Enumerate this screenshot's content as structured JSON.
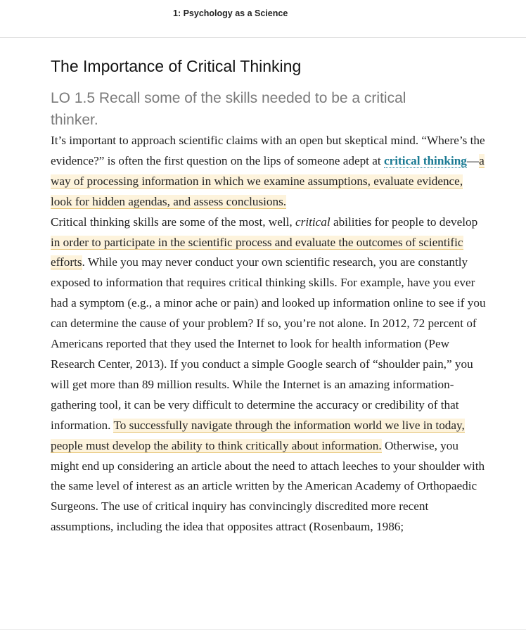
{
  "header": {
    "chapter_title": "1: Psychology as a Science"
  },
  "section": {
    "title": "The Importance of Critical Thinking",
    "learning_objective": "LO 1.5 Recall some of the skills needed to be a critical thinker."
  },
  "paragraph1": {
    "intro": "It’s important to approach scientific claims with an open but skeptical mind. “Where’s the evidence?” is often the first question on the lips of someone adept at ",
    "term": "critical thinking",
    "dash": "—",
    "definition": "a way of processing information in which we examine assumptions, evaluate evidence, look for hidden agendas, and assess conclusions."
  },
  "paragraph2": {
    "s1": "Critical thinking skills are some of the most, well, ",
    "s1_em": "critical",
    "s1_end": " abilities for people to develop ",
    "h1": "in order to participate in the scientific process and evaluate the outcomes of scientific efforts",
    "s2": ". While you may never conduct your own scientific research, you are constantly exposed to information that requires critical thinking skills. For example, have you ever had a symptom (e.g., a minor ache or pain) and looked up information online to see if you can determine the cause of your problem? If so, you’re not alone. In 2012, 72 percent of Americans reported that they used the Internet to look for health information (Pew Research Center, 2013). If you conduct a simple Google search of “shoulder pain,” you will get more than 89 million results. While the Internet is an amazing information-gathering tool, it can be very difficult to determine the accuracy or credibility of that information. ",
    "h2": "To successfully navigate through the information world we live in today, people must develop the ability to think critically about information.",
    "s3": " Otherwise, you might end up considering an article about the need to attach leeches to your shoulder with the same level of interest as an article written by the American Academy of Orthopaedic Surgeons. The use of critical inquiry has convincingly discredited more recent assumptions, including the idea that opposites attract (Rosenbaum, 1986;"
  },
  "colors": {
    "highlight_bg": "#fdf3dc",
    "highlight_underline": "#e8c77a",
    "term_link": "#1a7a93",
    "objective_gray": "#7a7a7a"
  }
}
